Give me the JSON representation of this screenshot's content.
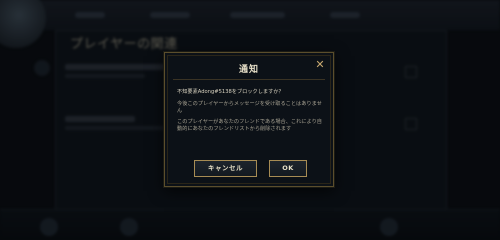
{
  "background": {
    "panel_title": "プレイヤーの関連"
  },
  "dialog": {
    "title": "通知",
    "question": "不知要素Adong#5138をブロックしますか？",
    "line1": "今後このプレイヤーからメッセージを受け取ることはありません",
    "line2": "このプレイヤーがあなたのフレンドである場合、これにより自動的にあなたのフレンドリストから削除されます",
    "cancel_label": "キャンセル",
    "ok_label": "OK"
  },
  "colors": {
    "accent_gold": "#c9aa71",
    "dialog_bg": "#0c1117",
    "button_border": "#a78c54"
  }
}
